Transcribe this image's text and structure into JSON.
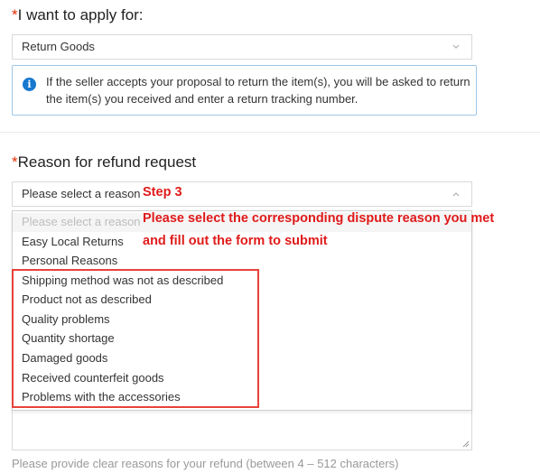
{
  "apply_section": {
    "required_mark": "*",
    "label": "I want to apply for:",
    "selected_value": "Return Goods",
    "info_text": "If the seller accepts your proposal to return the item(s), you will be asked to return the item(s) you received and enter a return tracking number."
  },
  "reason_section": {
    "required_mark": "*",
    "label": "Reason for refund request",
    "placeholder": "Please select a reason",
    "options": [
      "Please select a reason",
      "Easy Local Returns",
      "Personal Reasons",
      "Shipping method was not as described",
      "Product not as described",
      "Quality problems",
      "Quantity shortage",
      "Damaged goods",
      "Received counterfeit goods",
      "Problems with the accessories"
    ]
  },
  "annotations": {
    "step_label": "Step 3",
    "instruction_line1": "Please select the corresponding dispute reason you met",
    "instruction_line2": "and fill out the form to submit"
  },
  "description_section": {
    "hint": "Please provide clear reasons for your refund (between 4 – 512 characters)"
  },
  "colors": {
    "required": "#e62e04",
    "annotation": "#e01a1a",
    "info_icon": "#1678ce",
    "highlight_frame": "#e8423b"
  },
  "icons": [
    "info-icon",
    "chevron-down-icon",
    "chevron-up-icon",
    "resize-grip-icon"
  ]
}
